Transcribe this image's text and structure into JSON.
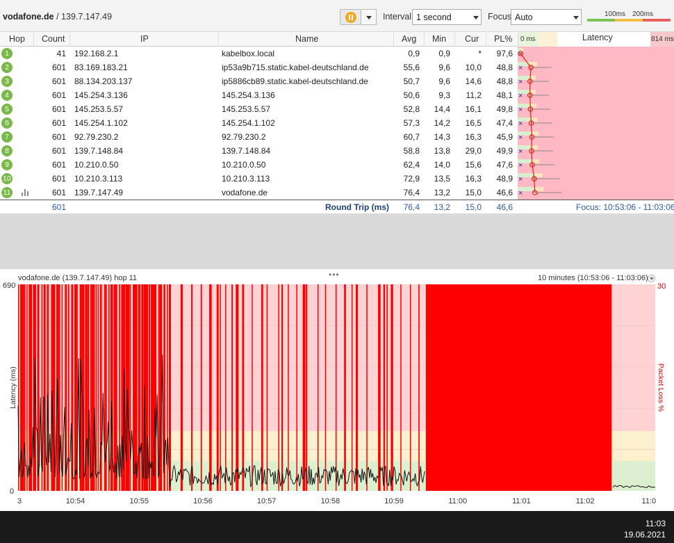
{
  "toolbar": {
    "target_host": "vodafone.de",
    "target_ip": " / 139.7.147.49",
    "interval_label": "Interval",
    "interval_value": "1 second",
    "focus_label": "Focus",
    "focus_value": "Auto",
    "legend_100": "100ms",
    "legend_200": "200ms"
  },
  "columns": {
    "hop": "Hop",
    "count": "Count",
    "ip": "IP",
    "name": "Name",
    "avg": "Avg",
    "min": "Min",
    "cur": "Cur",
    "pl": "PL%",
    "latency_min": "0 ms",
    "latency": "Latency",
    "latency_max": "814 ms"
  },
  "hops": [
    {
      "hop": "1",
      "count": "41",
      "ip": "192.168.2.1",
      "name": "kabelbox.local",
      "avg": "0,9",
      "min": "0,9",
      "cur": "*",
      "pl": "97,6"
    },
    {
      "hop": "2",
      "count": "601",
      "ip": "83.169.183.21",
      "name": "ip53a9b715.static.kabel-deutschland.de",
      "avg": "55,6",
      "min": "9,6",
      "cur": "10,0",
      "pl": "48,8"
    },
    {
      "hop": "3",
      "count": "601",
      "ip": "88.134.203.137",
      "name": "ip5886cb89.static.kabel-deutschland.de",
      "avg": "50,7",
      "min": "9,6",
      "cur": "14,6",
      "pl": "48,8"
    },
    {
      "hop": "4",
      "count": "601",
      "ip": "145.254.3.136",
      "name": "145.254.3.136",
      "avg": "50,6",
      "min": "9,3",
      "cur": "11,2",
      "pl": "48,1"
    },
    {
      "hop": "5",
      "count": "601",
      "ip": "145.253.5.57",
      "name": "145.253.5.57",
      "avg": "52,8",
      "min": "14,4",
      "cur": "16,1",
      "pl": "49,8"
    },
    {
      "hop": "6",
      "count": "601",
      "ip": "145.254.1.102",
      "name": "145.254.1.102",
      "avg": "57,3",
      "min": "14,2",
      "cur": "16,5",
      "pl": "47,4"
    },
    {
      "hop": "7",
      "count": "601",
      "ip": "92.79.230.2",
      "name": "92.79.230.2",
      "avg": "60,7",
      "min": "14,3",
      "cur": "16,3",
      "pl": "45,9"
    },
    {
      "hop": "8",
      "count": "601",
      "ip": "139.7.148.84",
      "name": "139.7.148.84",
      "avg": "58,8",
      "min": "13,8",
      "cur": "29,0",
      "pl": "49,9"
    },
    {
      "hop": "9",
      "count": "601",
      "ip": "10.210.0.50",
      "name": "10.210.0.50",
      "avg": "62,4",
      "min": "14,0",
      "cur": "15,6",
      "pl": "47,6"
    },
    {
      "hop": "10",
      "count": "601",
      "ip": "10.210.3.113",
      "name": "10.210.3.113",
      "avg": "72,9",
      "min": "13,5",
      "cur": "16,3",
      "pl": "48,9"
    },
    {
      "hop": "11",
      "count": "601",
      "ip": "139.7.147.49",
      "name": "vodafone.de",
      "avg": "76,4",
      "min": "13,2",
      "cur": "15,0",
      "pl": "46,6"
    }
  ],
  "summary": {
    "count": "601",
    "label": "Round Trip (ms)",
    "avg": "76,4",
    "min": "13,2",
    "cur": "15,0",
    "pl": "46,6",
    "focus": "Focus: 10:53:06 - 11:03:06"
  },
  "graph": {
    "title": "vodafone.de (139.7.147.49) hop 11",
    "range": "10 minutes (10:53:06 - 11:03:06)",
    "ylabel": "Latency (ms)",
    "y2label": "Packet Loss %",
    "ymax": "690",
    "ymin": "0",
    "y2max": "30",
    "xticks": [
      "3",
      "10:54",
      "10:55",
      "10:56",
      "10:57",
      "10:58",
      "10:59",
      "11:00",
      "11:01",
      "11:02",
      "11:0"
    ]
  },
  "chart_data": {
    "type": "line",
    "title": "vodafone.de (139.7.147.49) hop 11",
    "xlabel": "",
    "ylabel": "Latency (ms)",
    "y2label": "Packet Loss %",
    "ylim": [
      0,
      690
    ],
    "y2lim": [
      0,
      30
    ],
    "x_range": [
      "10:53:06",
      "11:03:06"
    ],
    "full_loss_interval": [
      "10:59:30",
      "11:02:25"
    ],
    "grid": false
  },
  "taskbar": {
    "time": "11:03",
    "date": "19.06.2021"
  },
  "colors": {
    "loss": "#ff0000",
    "bg_high": "#ffd3d3",
    "bg_mid": "#fdf0cf",
    "bg_low": "#daf0cf",
    "hop_badge": "#7ab84a"
  }
}
